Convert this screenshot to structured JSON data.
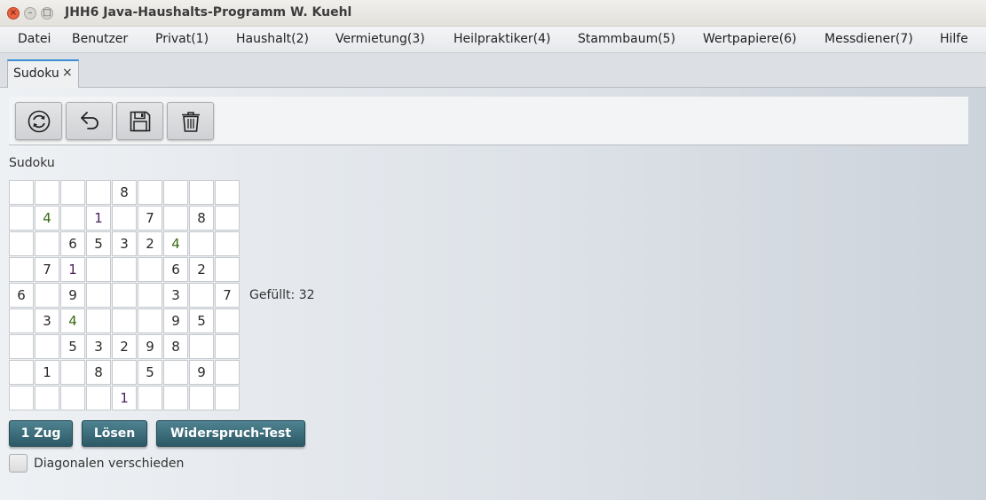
{
  "window": {
    "title": "JHH6 Java-Haushalts-Programm W. Kuehl",
    "close_glyph": "×",
    "min_glyph": "–",
    "max_glyph": "□"
  },
  "menu": [
    {
      "label": "Datei"
    },
    {
      "label": "Benutzer"
    },
    {
      "label": "Privat(1)"
    },
    {
      "label": "Haushalt(2)"
    },
    {
      "label": "Vermietung(3)"
    },
    {
      "label": "Heilpraktiker(4)"
    },
    {
      "label": "Stammbaum(5)"
    },
    {
      "label": "Wertpapiere(6)"
    },
    {
      "label": "Messdiener(7)"
    },
    {
      "label": "Hilfe"
    }
  ],
  "tab": {
    "label": "Sudoku",
    "close_glyph": "×"
  },
  "toolbar": {
    "buttons": [
      {
        "icon": "refresh-icon"
      },
      {
        "icon": "undo-icon"
      },
      {
        "icon": "save-icon"
      },
      {
        "icon": "trash-icon"
      }
    ]
  },
  "sudoku": {
    "label": "Sudoku",
    "rows": [
      [
        "",
        "",
        "",
        "",
        "8",
        "",
        "",
        "",
        ""
      ],
      [
        "",
        "4",
        "",
        "1",
        "",
        "7",
        "",
        "8",
        ""
      ],
      [
        "",
        "",
        "6",
        "5",
        "3",
        "2",
        "4",
        "",
        ""
      ],
      [
        "",
        "7",
        "1",
        "",
        "",
        "",
        "6",
        "2",
        ""
      ],
      [
        "6",
        "",
        "9",
        "",
        "",
        "",
        "3",
        "",
        "7"
      ],
      [
        "",
        "3",
        "4",
        "",
        "",
        "",
        "9",
        "5",
        ""
      ],
      [
        "",
        "",
        "5",
        "3",
        "2",
        "9",
        "8",
        "",
        ""
      ],
      [
        "",
        "1",
        "",
        "8",
        "",
        "5",
        "",
        "9",
        ""
      ],
      [
        "",
        "",
        "",
        "",
        "1",
        "",
        "",
        "",
        ""
      ]
    ],
    "filled_text": "Gefüllt: 32",
    "colors": {
      "default": "#2a2a2a",
      "green": "#3b6b12",
      "purple": "#4a1f5c"
    }
  },
  "actions": {
    "step": "1 Zug",
    "solve": "Lösen",
    "contradiction": "Widerspruch-Test"
  },
  "options": {
    "diagonal_label": "Diagonalen verschieden",
    "diagonal_checked": false
  }
}
